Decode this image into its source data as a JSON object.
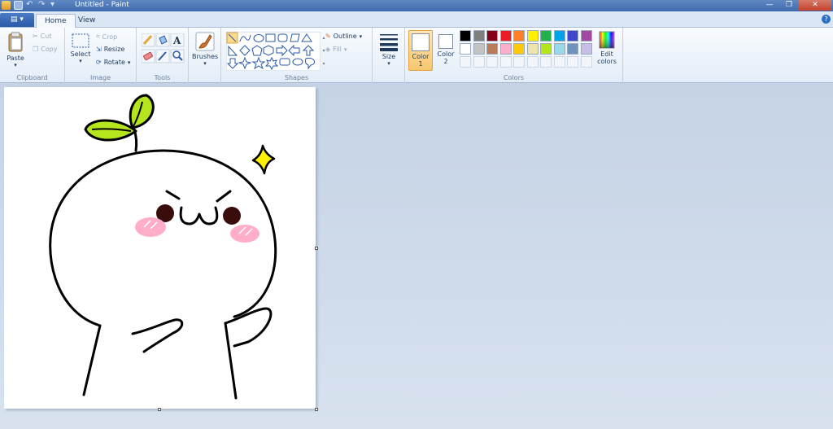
{
  "window": {
    "title": "Untitled - Paint"
  },
  "tabs": {
    "home": "Home",
    "view": "View"
  },
  "help": "?",
  "clipboard": {
    "label": "Clipboard",
    "paste": "Paste",
    "cut": "Cut",
    "copy": "Copy"
  },
  "image": {
    "label": "Image",
    "select": "Select",
    "crop": "Crop",
    "resize": "Resize",
    "rotate": "Rotate"
  },
  "tools": {
    "label": "Tools"
  },
  "brushes": {
    "label": "Brushes"
  },
  "shapes": {
    "label": "Shapes",
    "outline": "Outline",
    "fill": "Fill"
  },
  "size": {
    "label": "Size"
  },
  "colors": {
    "label": "Colors",
    "color1": "Color 1",
    "color2": "Color 2",
    "edit": "Edit colors",
    "row1": [
      "#000000",
      "#7f7f7f",
      "#880015",
      "#ed1c24",
      "#ff7f27",
      "#fff200",
      "#22b14c",
      "#00a2e8",
      "#3f48cc",
      "#a349a4"
    ],
    "row2": [
      "#ffffff",
      "#c3c3c3",
      "#b97a57",
      "#ffaec9",
      "#ffc90e",
      "#efe4b0",
      "#b5e61d",
      "#99d9ea",
      "#7092be",
      "#c8bfe7"
    ]
  }
}
